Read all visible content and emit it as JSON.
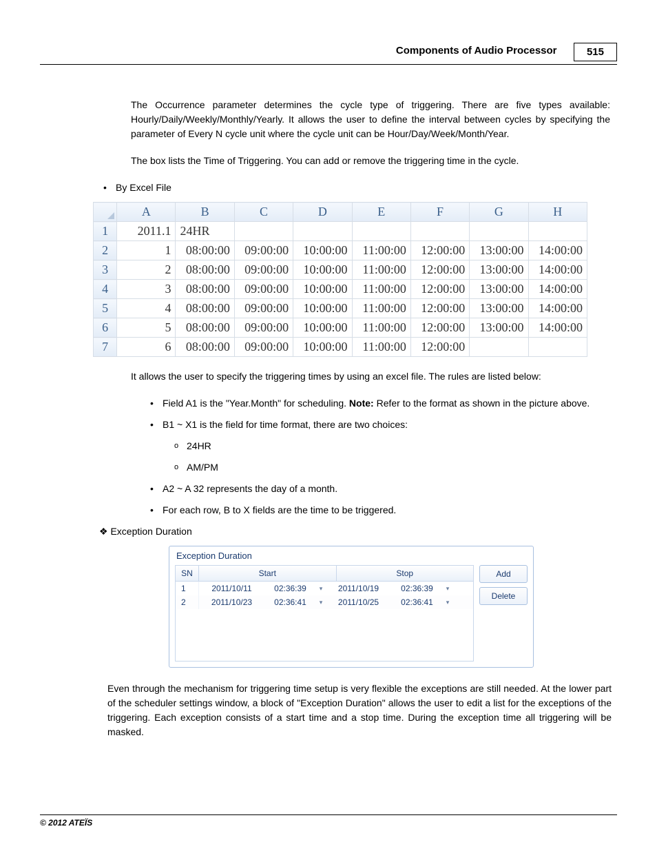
{
  "header": {
    "title": "Components of Audio Processor",
    "page_number": "515"
  },
  "intro": {
    "p1": "The Occurrence parameter determines the cycle type of triggering. There are five types available: Hourly/Daily/Weekly/Monthly/Yearly. It allows the user to define the interval between cycles by specifying the parameter of Every N cycle unit where the cycle unit can be Hour/Day/Week/Month/Year.",
    "p2": "The box lists the Time of Triggering. You can add or remove the triggering time in the cycle."
  },
  "bullet_by_excel": "By Excel File",
  "excel": {
    "columns": [
      "A",
      "B",
      "C",
      "D",
      "E",
      "F",
      "G",
      "H"
    ],
    "row_indices": [
      "1",
      "2",
      "3",
      "4",
      "5",
      "6",
      "7"
    ],
    "a1": "2011.1",
    "b1": "24HR",
    "times": [
      "08:00:00",
      "09:00:00",
      "10:00:00",
      "11:00:00",
      "12:00:00",
      "13:00:00",
      "14:00:00"
    ],
    "days": [
      "1",
      "2",
      "3",
      "4",
      "5",
      "6"
    ],
    "last_row_cols_filled": 5
  },
  "after_excel": {
    "p1": "It allows the user to specify the triggering times by using an excel file. The rules are listed below:",
    "rules": [
      {
        "pre": "Field A1 is the \"Year.Month\" for scheduling. ",
        "bold": "Note:",
        "post": " Refer to the format as shown in the picture above."
      },
      {
        "text": "B1 ~ X1 is the field for time format, there are two choices:",
        "sub": [
          "24HR",
          "AM/PM"
        ]
      },
      {
        "text": "A2 ~ A 32 represents the day of a month."
      },
      {
        "text": "For each row, B to X fields are the time to be triggered."
      }
    ]
  },
  "exception": {
    "section_label": "Exception Duration",
    "panel_title": "Exception Duration",
    "headers": {
      "sn": "SN",
      "start": "Start",
      "stop": "Stop"
    },
    "rows": [
      {
        "sn": "1",
        "start_date": "2011/10/11",
        "start_time": "02:36:39",
        "stop_date": "2011/10/19",
        "stop_time": "02:36:39"
      },
      {
        "sn": "2",
        "start_date": "2011/10/23",
        "start_time": "02:36:41",
        "stop_date": "2011/10/25",
        "stop_time": "02:36:41"
      }
    ],
    "buttons": {
      "add": "Add",
      "delete": "Delete"
    },
    "para": "Even through the mechanism for triggering time setup is very flexible the exceptions are still needed. At the lower part of the scheduler settings window, a block of \"Exception Duration\" allows the user to edit a list for the exceptions of the triggering. Each exception consists of a start time and a stop time. During the exception time all triggering will be masked."
  },
  "footer": "© 2012 ATEÏS"
}
